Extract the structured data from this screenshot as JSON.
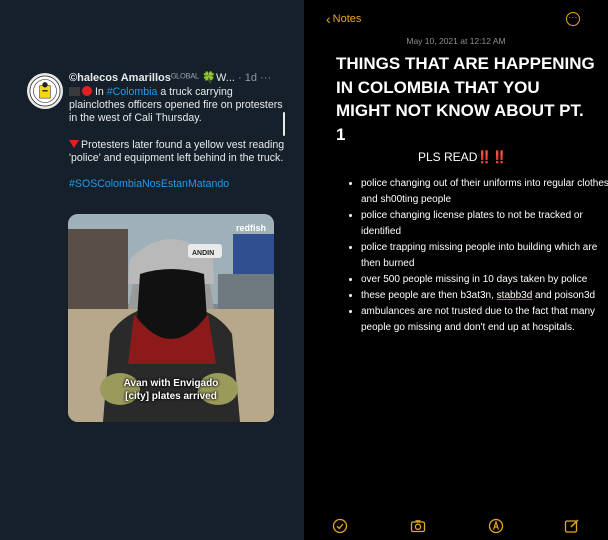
{
  "tweet": {
    "display_name": "©halecos Amarillos",
    "name_suffix": "ᴳᴸᴼᴮᴬᴸ",
    "clover": "🍀",
    "name_ellipsis": "W...",
    "separator": "·",
    "time": "1d",
    "more": "···",
    "line1_prefix": "In ",
    "hashtag_colombia": "#Colombia",
    "line1_rest": " a truck carrying plainclothes officers opened fire on protesters in the west of Cali Thursday.",
    "line2": "Protesters later found a yellow vest reading 'police' and equipment left behind in the truck.",
    "hashtag_main": "#SOSColombiaNosEstanMatando",
    "media": {
      "watermark": "redfish",
      "helmet_text": "ANDIN",
      "caption_line1": "Avan with Envigado",
      "caption_line2": "[city] plates arrived"
    }
  },
  "notes": {
    "back_label": "Notes",
    "date": "May 10, 2021 at 12:12 AM",
    "title": "THINGS THAT ARE HAPPENING IN COLOMBIA THAT YOU MIGHT NOT KNOW ABOUT PT. 1",
    "pls_read": "PLS READ",
    "pls_bangs": "‼️‼️",
    "items": [
      "police changing out of their uniforms into regular clothes and sh00ting people",
      "police changing license plates to not be tracked or identified",
      "police trapping missing people into building which are then burned",
      "over 500 people missing in 10 days taken by police",
      "ambulances are not trusted due to the fact that many people go missing and don't end up at hospitals."
    ],
    "item5_prefix": "these people are then b3at3n, ",
    "item5_underlined": "stabb3d",
    "item5_suffix": " and poison3d"
  },
  "colors": {
    "tweet_bg": "#15202b",
    "link": "#1d9bf0",
    "notes_accent": "#e6a722",
    "alert_red": "#ff3b30"
  },
  "icons": {
    "toolbar": [
      "checklist-icon",
      "camera-icon",
      "markup-icon",
      "compose-icon"
    ]
  }
}
